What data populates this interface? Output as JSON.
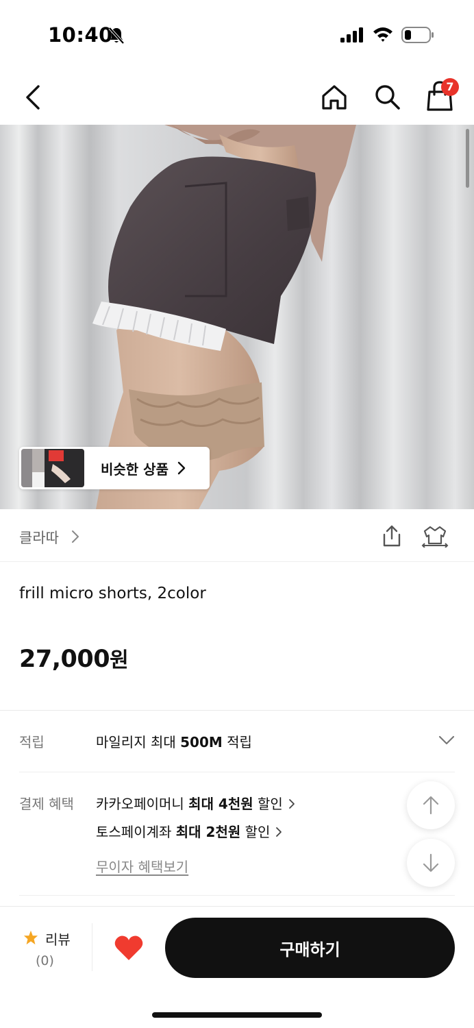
{
  "status_bar": {
    "time": "10:40"
  },
  "nav": {
    "cart_count": "7"
  },
  "product": {
    "similar_label": "비슷한 상품",
    "brand": "클라따",
    "title": "frill micro shorts, 2color",
    "price": "27,000",
    "price_unit": "원"
  },
  "benefits": {
    "mileage_label": "적립",
    "mileage_pre": "마일리지 최대 ",
    "mileage_bold": "500M",
    "mileage_post": " 적립",
    "payment_label": "결제 혜택",
    "kakao_pre": "카카오페이머니 ",
    "kakao_bold": "최대 4천원",
    "kakao_post": " 할인",
    "toss_pre": "토스페이계좌 ",
    "toss_bold": "최대 2천원",
    "toss_post": " 할인",
    "installment_link": "무이자 혜택보기"
  },
  "bottom_bar": {
    "review_label": "리뷰",
    "review_count": "(0)",
    "buy_label": "구매하기"
  },
  "colors": {
    "badge": "#e8332a",
    "heart": "#f03b2f",
    "star": "#f5a623",
    "buy_button": "#111111"
  },
  "icons": [
    "bell-off-icon",
    "signal-icon",
    "wifi-icon",
    "battery-icon",
    "back-icon",
    "home-icon",
    "search-icon",
    "cart-icon",
    "chevron-right-icon",
    "share-icon",
    "fit-icon",
    "chevron-down-icon",
    "arrow-up-icon",
    "arrow-down-icon",
    "star-icon",
    "heart-icon"
  ]
}
